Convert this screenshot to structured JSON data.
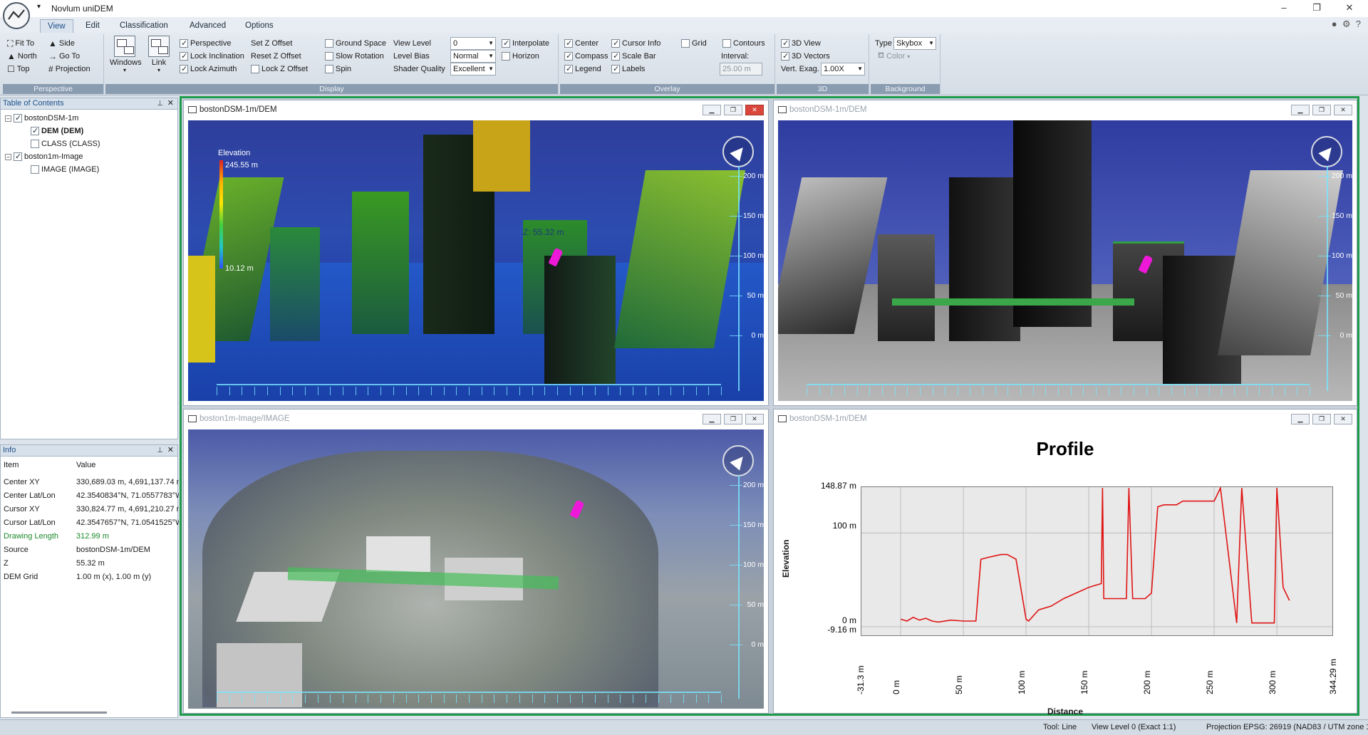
{
  "app": {
    "title": "Novlum uniDEM"
  },
  "window": {
    "minimize": "–",
    "maximize": "❐",
    "close": "✕"
  },
  "tabs": [
    "View",
    "Edit",
    "Classification",
    "Advanced",
    "Options"
  ],
  "ribbon": {
    "perspective": {
      "label": "Perspective",
      "fit_to": "Fit To",
      "side": "Side",
      "north": "North",
      "go_to": "Go To",
      "top": "Top",
      "projection": "Projection"
    },
    "display": {
      "label": "Display",
      "windows": "Windows",
      "link": "Link",
      "perspective": "Perspective",
      "lock_inclination": "Lock Inclination",
      "lock_azimuth": "Lock Azimuth",
      "set_z_offset": "Set Z Offset",
      "reset_z_offset": "Reset Z Offset",
      "lock_z_offset": "Lock Z Offset",
      "ground_space": "Ground Space",
      "slow_rotation": "Slow Rotation",
      "spin": "Spin",
      "view_level": "View Level",
      "level_bias": "Level Bias",
      "shader_quality": "Shader Quality",
      "view_level_value": "0",
      "level_bias_value": "Normal",
      "shader_quality_value": "Excellent",
      "interpolate": "Interpolate",
      "horizon": "Horizon"
    },
    "overlay": {
      "label": "Overlay",
      "center": "Center",
      "compass": "Compass",
      "legend": "Legend",
      "cursor_info": "Cursor Info",
      "scale_bar": "Scale Bar",
      "labels": "Labels",
      "grid": "Grid",
      "contours": "Contours",
      "interval": "Interval:",
      "interval_value": "25.00 m"
    },
    "three_d": {
      "label": "3D",
      "view_3d": "3D View",
      "vectors_3d": "3D Vectors",
      "vert_exag": "Vert. Exag.",
      "vert_exag_value": "1.00X"
    },
    "background": {
      "label": "Background",
      "type": "Type",
      "type_value": "Skybox",
      "color": "Color"
    }
  },
  "toc": {
    "title": "Table of Contents",
    "items": [
      {
        "label": "bostonDSM-1m"
      },
      {
        "label": "DEM (DEM)"
      },
      {
        "label": "CLASS (CLASS)"
      },
      {
        "label": "boston1m-Image"
      },
      {
        "label": "IMAGE (IMAGE)"
      }
    ]
  },
  "info": {
    "title": "Info",
    "col_item": "Item",
    "col_value": "Value",
    "rows": [
      {
        "k": "Center XY",
        "v": "330,689.03 m, 4,691,137.74 m"
      },
      {
        "k": "Center Lat/Lon",
        "v": "42.3540834°N, 71.0557783°W"
      },
      {
        "k": "Cursor XY",
        "v": "330,824.77 m, 4,691,210.27 m"
      },
      {
        "k": "Cursor Lat/Lon",
        "v": "42.3547657°N, 71.0541525°W"
      },
      {
        "k": "Drawing Length",
        "v": "312.99 m"
      },
      {
        "k": "Source",
        "v": "bostonDSM-1m/DEM"
      },
      {
        "k": "Z",
        "v": "55.32 m"
      },
      {
        "k": "DEM Grid",
        "v": "1.00 m (x), 1.00 m (y)"
      }
    ]
  },
  "views": {
    "v1": {
      "title": "bostonDSM-1m/DEM"
    },
    "v2": {
      "title": "bostonDSM-1m/DEM"
    },
    "v3": {
      "title": "boston1m-Image/IMAGE"
    },
    "v4": {
      "title": "bostonDSM-1m/DEM"
    },
    "legend_title": "Elevation",
    "legend_max": "245.55 m",
    "legend_min": "10.12 m",
    "z_label": "Z: 55.32 m",
    "scale_labels": [
      "200 m",
      "150 m",
      "100 m",
      "50 m",
      "0 m"
    ]
  },
  "profile": {
    "title": "Profile",
    "ylabel": "Elevation",
    "xlabel": "Distance",
    "yticks": [
      "148.87 m",
      "100 m",
      "0 m",
      "-9.16 m"
    ],
    "xticks": [
      "-31.3 m",
      "0 m",
      "50 m",
      "100 m",
      "150 m",
      "200 m",
      "250 m",
      "300 m",
      "344.29 m"
    ]
  },
  "chart_data": {
    "type": "line",
    "title": "Profile",
    "xlabel": "Distance",
    "ylabel": "Elevation",
    "xlim": [
      -31.3,
      344.29
    ],
    "ylim": [
      -9.16,
      148.87
    ],
    "x": [
      0,
      5,
      10,
      15,
      20,
      25,
      30,
      40,
      50,
      60,
      64,
      70,
      80,
      85,
      92,
      100,
      102,
      110,
      120,
      130,
      140,
      150,
      155,
      160,
      161,
      162,
      170,
      180,
      182,
      185,
      188,
      195,
      200,
      205,
      210,
      215,
      220,
      225,
      232,
      240,
      250,
      255,
      268,
      272,
      280,
      290,
      298,
      300,
      305,
      310
    ],
    "series": [
      {
        "values": [
          8,
          6,
          10,
          7,
          9,
          6,
          5,
          7,
          6,
          6,
          72,
          74,
          77,
          77,
          72,
          8,
          6,
          18,
          22,
          30,
          36,
          42,
          44,
          46,
          148,
          30,
          30,
          30,
          148,
          30,
          30,
          30,
          36,
          128,
          130,
          130,
          130,
          134,
          134,
          134,
          134,
          148,
          4,
          148,
          4,
          4,
          4,
          148,
          42,
          28
        ]
      }
    ]
  },
  "status": {
    "tool": "Tool: Line",
    "view_level": "View Level 0 (Exact 1:1)",
    "projection": "Projection EPSG: 26919 (NAD83 / UTM zone 19N)"
  }
}
